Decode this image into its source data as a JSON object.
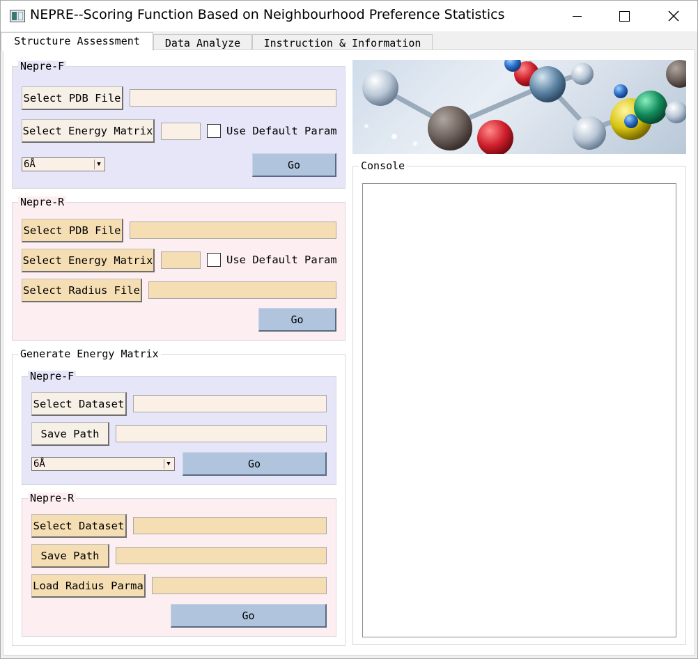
{
  "window": {
    "title": "NEPRE--Scoring Function Based on Neighbourhood Preference Statistics"
  },
  "tabs": [
    {
      "label": "Structure Assessment",
      "active": true
    },
    {
      "label": "Data Analyze",
      "active": false
    },
    {
      "label": "Instruction & Information",
      "active": false
    }
  ],
  "nepre_f": {
    "title": "Nepre-F",
    "select_pdb_label": "Select PDB File",
    "pdb_value": "",
    "select_energy_label": "Select Energy Matrix",
    "energy_value": "",
    "use_default_label": "Use Default Param",
    "use_default_checked": false,
    "radius_selected": "6Å",
    "go_label": "Go"
  },
  "nepre_r": {
    "title": "Nepre-R",
    "select_pdb_label": "Select PDB File",
    "pdb_value": "",
    "select_energy_label": "Select Energy Matrix",
    "energy_value": "",
    "use_default_label": "Use Default Param",
    "use_default_checked": false,
    "select_radius_label": "Select Radius File",
    "radius_value": "",
    "go_label": "Go"
  },
  "generate": {
    "title": "Generate Energy Matrix",
    "nepre_f": {
      "title": "Nepre-F",
      "select_dataset_label": "Select Dataset",
      "dataset_value": "",
      "save_path_label": "Save Path",
      "save_path_value": "",
      "radius_selected": "6Å",
      "go_label": "Go"
    },
    "nepre_r": {
      "title": "Nepre-R",
      "select_dataset_label": "Select Dataset",
      "dataset_value": "",
      "save_path_label": "Save Path",
      "save_path_value": "",
      "load_radius_label": "Load Radius Parma",
      "radius_value": "",
      "go_label": "Go"
    }
  },
  "console": {
    "title": "Console",
    "content": ""
  },
  "colors": {
    "lavender_panel": "#e6e6f8",
    "pink_panel": "#fdeef2",
    "wheat_button": "#f5deb3",
    "go_button": "#b0c4de"
  }
}
